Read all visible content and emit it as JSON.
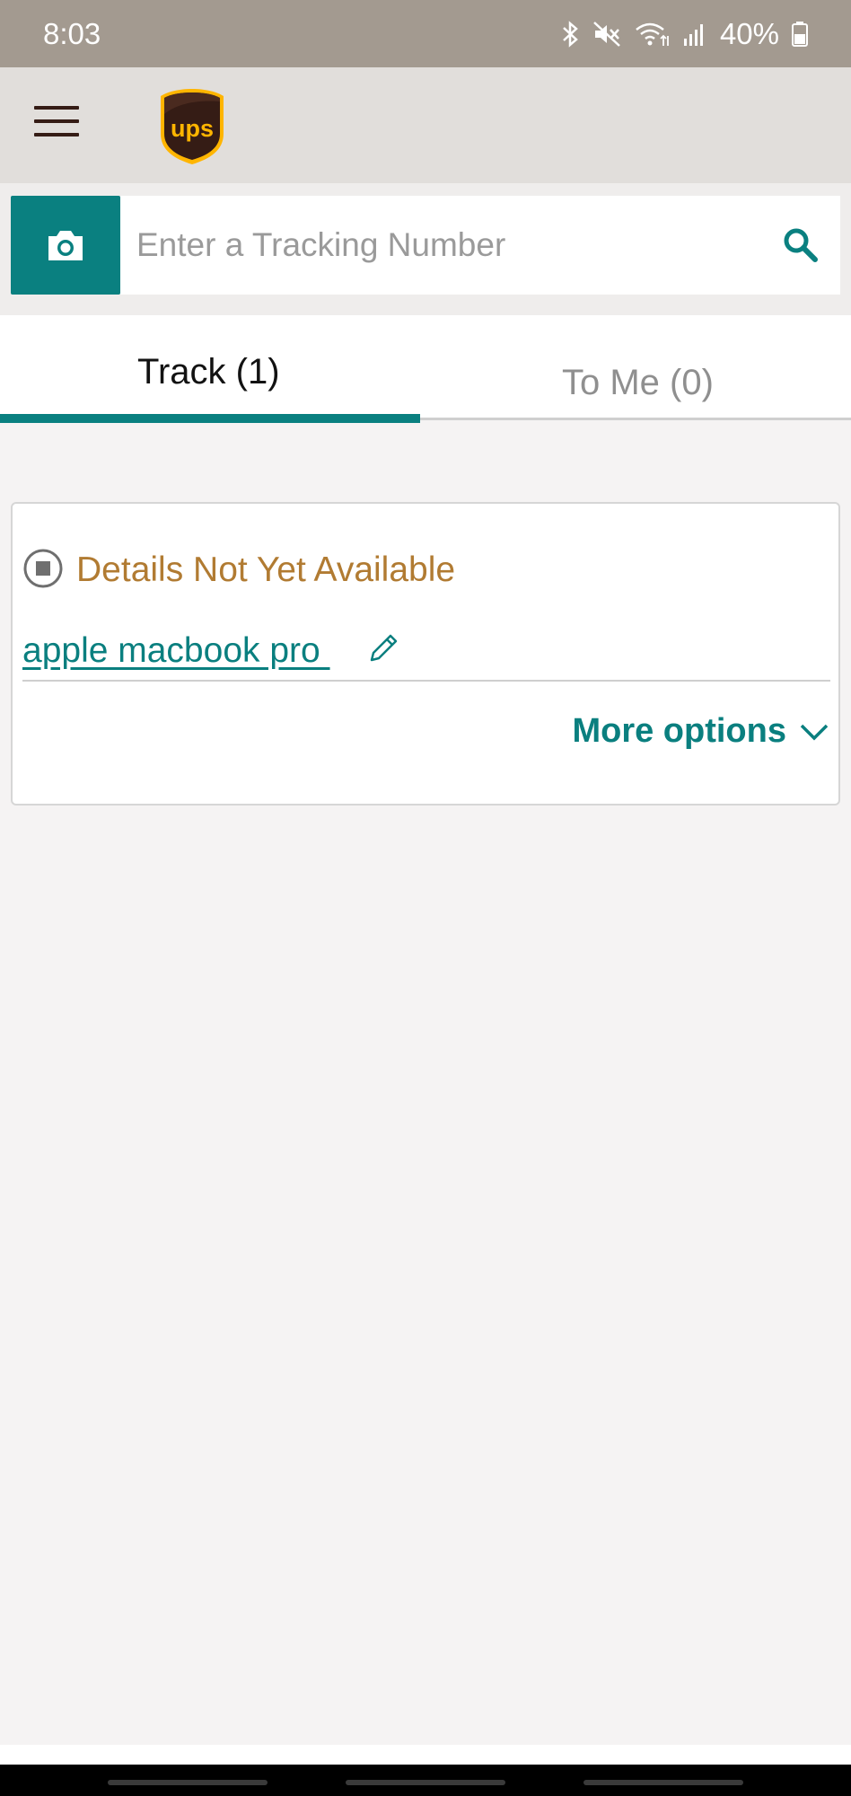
{
  "status_bar": {
    "time": "8:03",
    "battery": "40%",
    "icons": [
      "bluetooth-icon",
      "mute-icon",
      "wifi-icon",
      "signal-icon",
      "battery-icon"
    ]
  },
  "header": {
    "menu_icon": "hamburger-menu-icon",
    "logo_text": "ups"
  },
  "search": {
    "placeholder": "Enter a Tracking Number",
    "value": "",
    "camera_icon": "camera-icon",
    "search_icon": "search-icon"
  },
  "tabs": [
    {
      "label": "Track (1)",
      "active": true
    },
    {
      "label": "To Me (0)",
      "active": false
    }
  ],
  "package_card": {
    "status": "Details Not Yet Available",
    "name": "apple macbook pro ",
    "more_options": "More options"
  },
  "colors": {
    "status_bar": "#a39a90",
    "header": "#e1dedb",
    "accent_teal": "#0a8080",
    "status_text": "#b17b32",
    "ups_brown": "#351c15",
    "ups_gold": "#ffb500"
  }
}
